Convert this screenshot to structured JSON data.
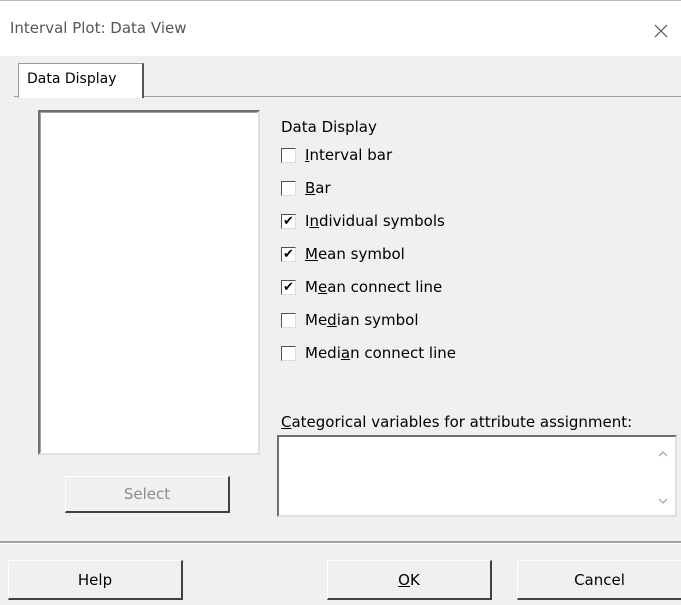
{
  "window": {
    "title": "Interval Plot: Data View",
    "close_icon": "close-icon"
  },
  "tabs": [
    {
      "label": "Data Display",
      "selected": true
    }
  ],
  "variables_list": {
    "items": [],
    "select_button": "Select",
    "select_enabled": false
  },
  "data_display": {
    "section_label": "Data Display",
    "options": [
      {
        "label": "Interval bar",
        "mnemonic_index": 0,
        "checked": false
      },
      {
        "label": "Bar",
        "mnemonic_index": 0,
        "checked": false
      },
      {
        "label": "Individual symbols",
        "mnemonic_index": 1,
        "checked": true
      },
      {
        "label": "Mean symbol",
        "mnemonic_index": 0,
        "checked": true
      },
      {
        "label": "Mean connect line",
        "mnemonic_index": 1,
        "checked": true
      },
      {
        "label": "Median symbol",
        "mnemonic_index": 2,
        "checked": false
      },
      {
        "label": "Median connect line",
        "mnemonic_index": 4,
        "checked": false
      }
    ]
  },
  "categorical": {
    "label": "Categorical variables for attribute assignment:",
    "mnemonic_index": 0,
    "value": ""
  },
  "footer": {
    "help": "Help",
    "ok": "OK",
    "ok_mnemonic_index": 0,
    "cancel": "Cancel"
  }
}
